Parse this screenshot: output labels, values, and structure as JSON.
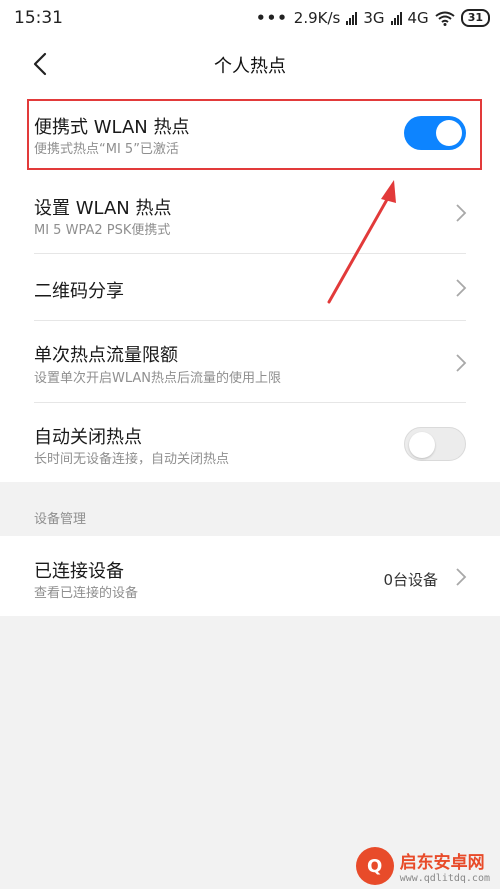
{
  "status_bar": {
    "time": "15:31",
    "more": "•••",
    "net_speed": "2.9K/s",
    "net_3g": "3G",
    "net_4g": "4G",
    "battery": "31"
  },
  "header": {
    "title": "个人热点"
  },
  "settings": {
    "portable_hotspot": {
      "title": "便携式 WLAN 热点",
      "subtitle": "便携式热点“MI 5”已激活",
      "enabled": true
    },
    "setup_hotspot": {
      "title": "设置 WLAN 热点",
      "subtitle": "MI 5 WPA2 PSK便携式"
    },
    "qr_share": {
      "title": "二维码分享"
    },
    "data_limit": {
      "title": "单次热点流量限额",
      "subtitle": "设置单次开启WLAN热点后流量的使用上限"
    },
    "auto_off": {
      "title": "自动关闭热点",
      "subtitle": "长时间无设备连接，自动关闭热点",
      "enabled": false
    }
  },
  "device_management": {
    "section_label": "设备管理",
    "connected": {
      "title": "已连接设备",
      "subtitle": "查看已连接的设备",
      "value": "0台设备"
    }
  },
  "watermark": {
    "name": "启东安卓网",
    "url": "www.qdlitdq.com"
  },
  "colors": {
    "accent": "#0d84ff",
    "highlight": "#e23a3a"
  }
}
